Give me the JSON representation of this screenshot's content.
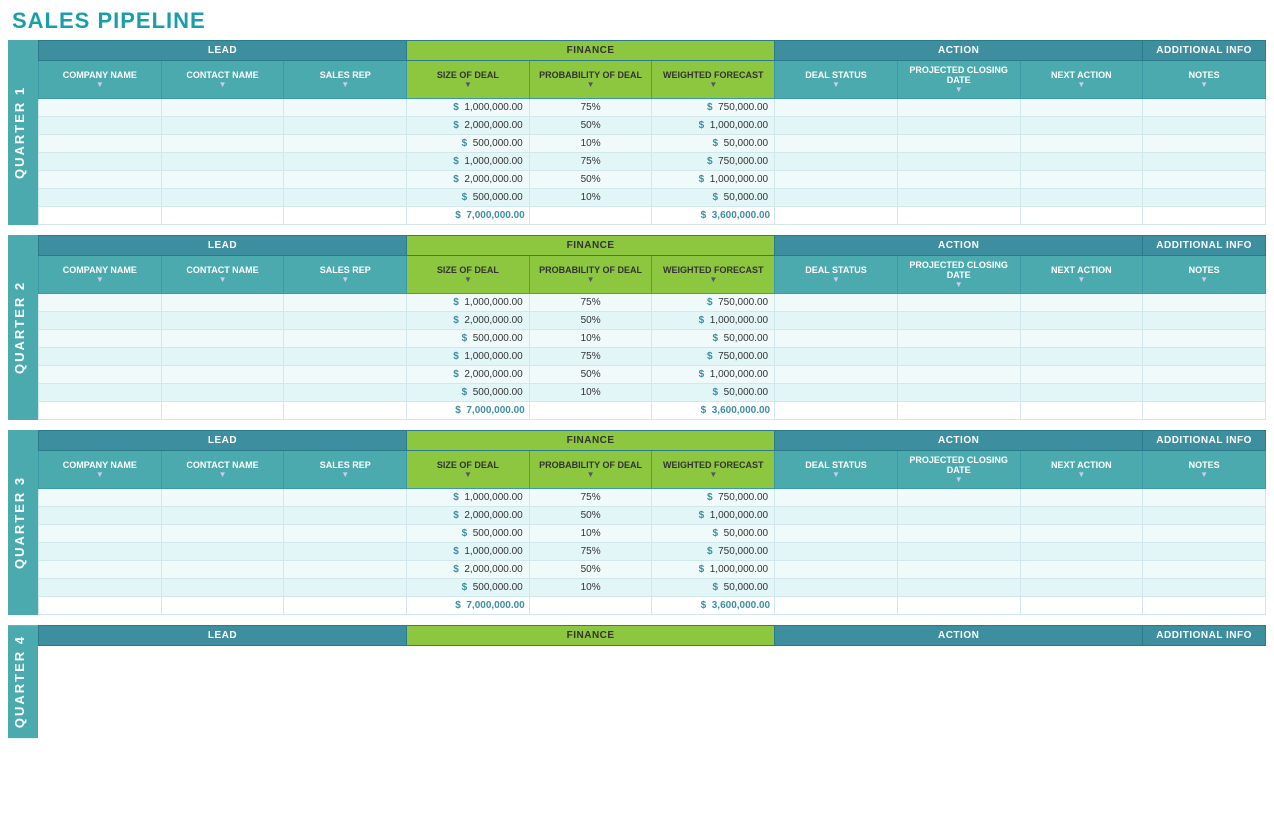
{
  "page": {
    "title": "SALES PIPELINE"
  },
  "categories": {
    "lead": "LEAD",
    "finance": "FINANCE",
    "action": "ACTION",
    "additional_info": "ADDITIONAL INFO"
  },
  "columns": {
    "company_name": "COMPANY NAME",
    "contact_name": "CONTACT NAME",
    "sales_rep": "SALES REP",
    "size_of_deal": "SIZE OF DEAL",
    "probability_of_deal": "PROBABILITY OF DEAL",
    "weighted_forecast": "WEIGHTED FORECAST",
    "deal_status": "DEAL STATUS",
    "projected_closing_date": "PROJECTED CLOSING DATE",
    "next_action": "NEXT ACTION",
    "notes": "NOTES"
  },
  "quarters": [
    {
      "label": "QUARTER 1",
      "rows": [
        {
          "size": "1,000,000.00",
          "prob": "75%",
          "weighted": "750,000.00"
        },
        {
          "size": "2,000,000.00",
          "prob": "50%",
          "weighted": "1,000,000.00"
        },
        {
          "size": "500,000.00",
          "prob": "10%",
          "weighted": "50,000.00"
        },
        {
          "size": "1,000,000.00",
          "prob": "75%",
          "weighted": "750,000.00"
        },
        {
          "size": "2,000,000.00",
          "prob": "50%",
          "weighted": "1,000,000.00"
        },
        {
          "size": "500,000.00",
          "prob": "10%",
          "weighted": "50,000.00"
        }
      ],
      "total_size": "7,000,000.00",
      "total_weighted": "3,600,000.00"
    },
    {
      "label": "QUARTER 2",
      "rows": [
        {
          "size": "1,000,000.00",
          "prob": "75%",
          "weighted": "750,000.00"
        },
        {
          "size": "2,000,000.00",
          "prob": "50%",
          "weighted": "1,000,000.00"
        },
        {
          "size": "500,000.00",
          "prob": "10%",
          "weighted": "50,000.00"
        },
        {
          "size": "1,000,000.00",
          "prob": "75%",
          "weighted": "750,000.00"
        },
        {
          "size": "2,000,000.00",
          "prob": "50%",
          "weighted": "1,000,000.00"
        },
        {
          "size": "500,000.00",
          "prob": "10%",
          "weighted": "50,000.00"
        }
      ],
      "total_size": "7,000,000.00",
      "total_weighted": "3,600,000.00"
    },
    {
      "label": "QUARTER 3",
      "rows": [
        {
          "size": "1,000,000.00",
          "prob": "75%",
          "weighted": "750,000.00"
        },
        {
          "size": "2,000,000.00",
          "prob": "50%",
          "weighted": "1,000,000.00"
        },
        {
          "size": "500,000.00",
          "prob": "10%",
          "weighted": "50,000.00"
        },
        {
          "size": "1,000,000.00",
          "prob": "75%",
          "weighted": "750,000.00"
        },
        {
          "size": "2,000,000.00",
          "prob": "50%",
          "weighted": "1,000,000.00"
        },
        {
          "size": "500,000.00",
          "prob": "10%",
          "weighted": "50,000.00"
        }
      ],
      "total_size": "7,000,000.00",
      "total_weighted": "3,600,000.00"
    }
  ],
  "partial_quarter": {
    "label": "QUARTER 4"
  }
}
